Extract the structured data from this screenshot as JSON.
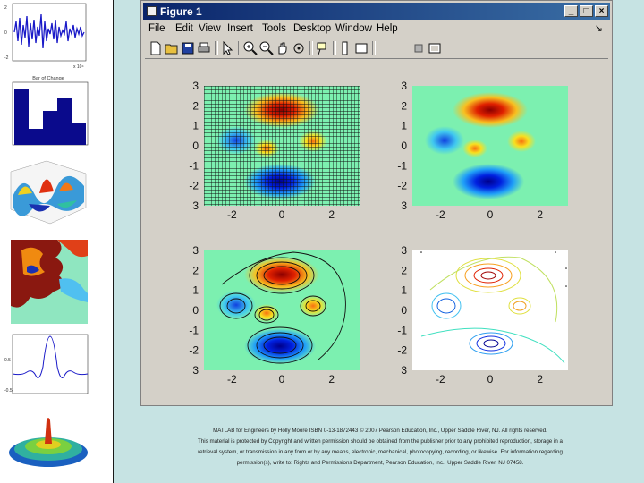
{
  "window": {
    "title": "Figure 1",
    "minimize_symbol": "_",
    "maximize_symbol": "□",
    "close_symbol": "×"
  },
  "menu": {
    "items": [
      "File",
      "Edit",
      "View",
      "Insert",
      "Tools",
      "Desktop",
      "Window",
      "Help"
    ],
    "dock_arrow": "↘"
  },
  "toolbar": {
    "buttons": [
      "new-file-icon",
      "open-folder-icon",
      "save-disk-icon",
      "print-icon",
      "select-arrow-icon",
      "zoom-in-icon",
      "zoom-out-icon",
      "pan-hand-icon",
      "rotate-3d-icon",
      "data-cursor-icon",
      "insert-colorbar-icon",
      "hide-plot-tools-icon",
      "show-plot-tools-icon"
    ]
  },
  "plots": {
    "y_ticks": [
      "3",
      "2",
      "1",
      "0",
      "-1",
      "-2",
      "3"
    ],
    "x_ticks": [
      "-2",
      "0",
      "2"
    ],
    "panels": [
      "mesh-plot",
      "pcolor-plot",
      "filled-contour-plot",
      "contour-plot"
    ]
  },
  "thumbnails": {
    "histogram_title": "Bar of Change",
    "signal_axis_note": "x 10⁴"
  },
  "caption": {
    "line1": "MATLAB for Engineers by Holly Moore ISBN 0-13-1872443 © 2007 Pearson Education, Inc., Upper Saddle River, NJ. All rights reserved.",
    "line2": "This material is protected by Copyright and written permission should be obtained from the publisher prior to any prohibited reproduction, storage in a",
    "line3": "retrieval system, or transmission in any form or by any means, electronic, mechanical, photocopying, recording, or likewise. For information regarding",
    "line4": "permission(s), write to: Rights and Permissions Department, Pearson Education, Inc., Upper Saddle River, NJ 07458."
  }
}
